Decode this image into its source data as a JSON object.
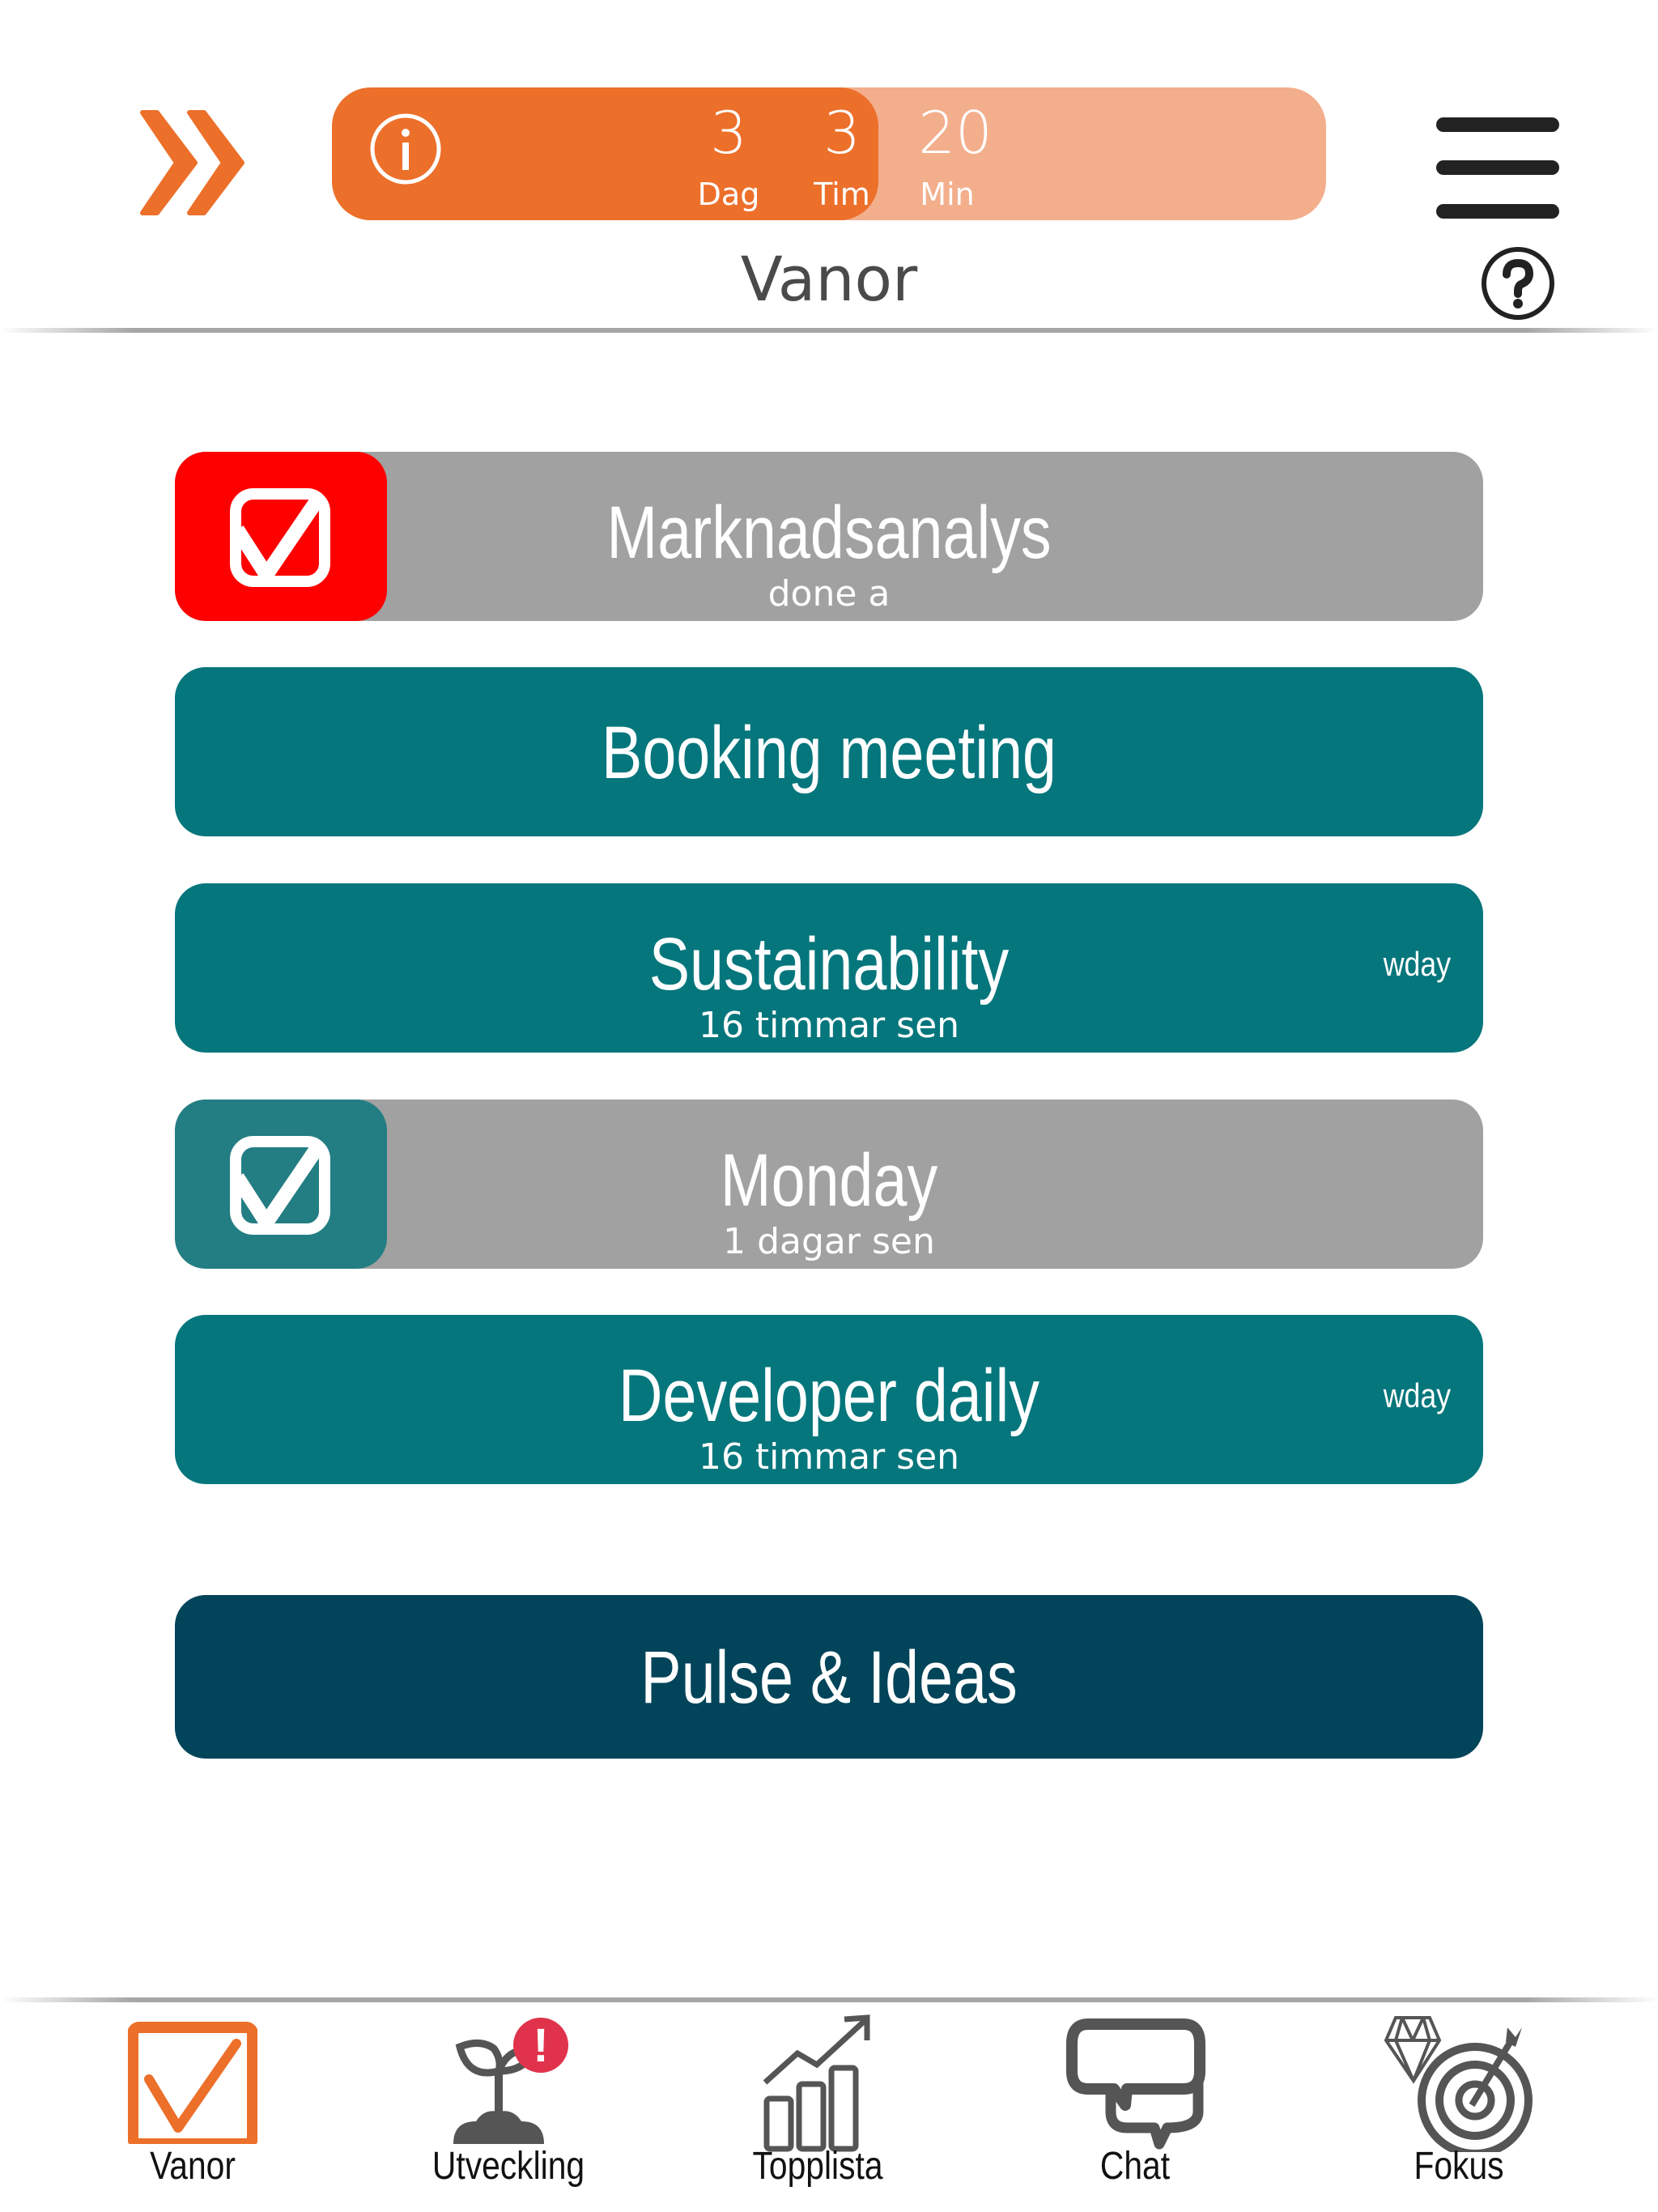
{
  "header": {
    "title": "Vanor",
    "timer": {
      "days": {
        "value": "3",
        "label": "Dag"
      },
      "hours": {
        "value": "3",
        "label": "Tim"
      },
      "minutes": {
        "value": "20",
        "label": "Min"
      },
      "elapsed_fraction": 0.55,
      "fill_color": "#ec6f2a",
      "track_color": "#f3ae8c"
    },
    "icons": {
      "back": "double-chevron-right-icon",
      "info": "info-icon",
      "menu": "hamburger-menu-icon",
      "help": "help-question-icon"
    }
  },
  "habits": [
    {
      "title": "Marknadsanalys",
      "subtitle": "done a",
      "badge": "",
      "state": "checked",
      "check_color": "#ff0000",
      "bg": "#a1a1a1"
    },
    {
      "title": "Booking meeting",
      "subtitle": "",
      "badge": "",
      "state": "open",
      "bg": "#05767c"
    },
    {
      "title": "Sustainability",
      "subtitle": "16 timmar sen",
      "badge": "wday",
      "state": "open",
      "bg": "#05767c"
    },
    {
      "title": "Monday",
      "subtitle": "1 dagar sen",
      "badge": "",
      "state": "checked",
      "check_color": "#237e83",
      "bg": "#a1a1a1"
    },
    {
      "title": "Developer daily",
      "subtitle": "16 timmar sen",
      "badge": "wday",
      "state": "open",
      "bg": "#05767c"
    }
  ],
  "pulse_button": {
    "label": "Pulse & Ideas",
    "bg": "#024459"
  },
  "bottom_nav": {
    "tabs": [
      {
        "label": "Vanor",
        "icon": "checkbox-icon",
        "active": true,
        "color": "#ec6f2a"
      },
      {
        "label": "Utveckling",
        "icon": "sprout-icon",
        "active": false,
        "badge": "!",
        "badge_color": "#e0334b"
      },
      {
        "label": "Topplista",
        "icon": "bar-chart-growth-icon",
        "active": false
      },
      {
        "label": "Chat",
        "icon": "chat-bubbles-icon",
        "active": false
      },
      {
        "label": "Fokus",
        "icon": "target-diamond-icon",
        "active": false
      }
    ]
  }
}
